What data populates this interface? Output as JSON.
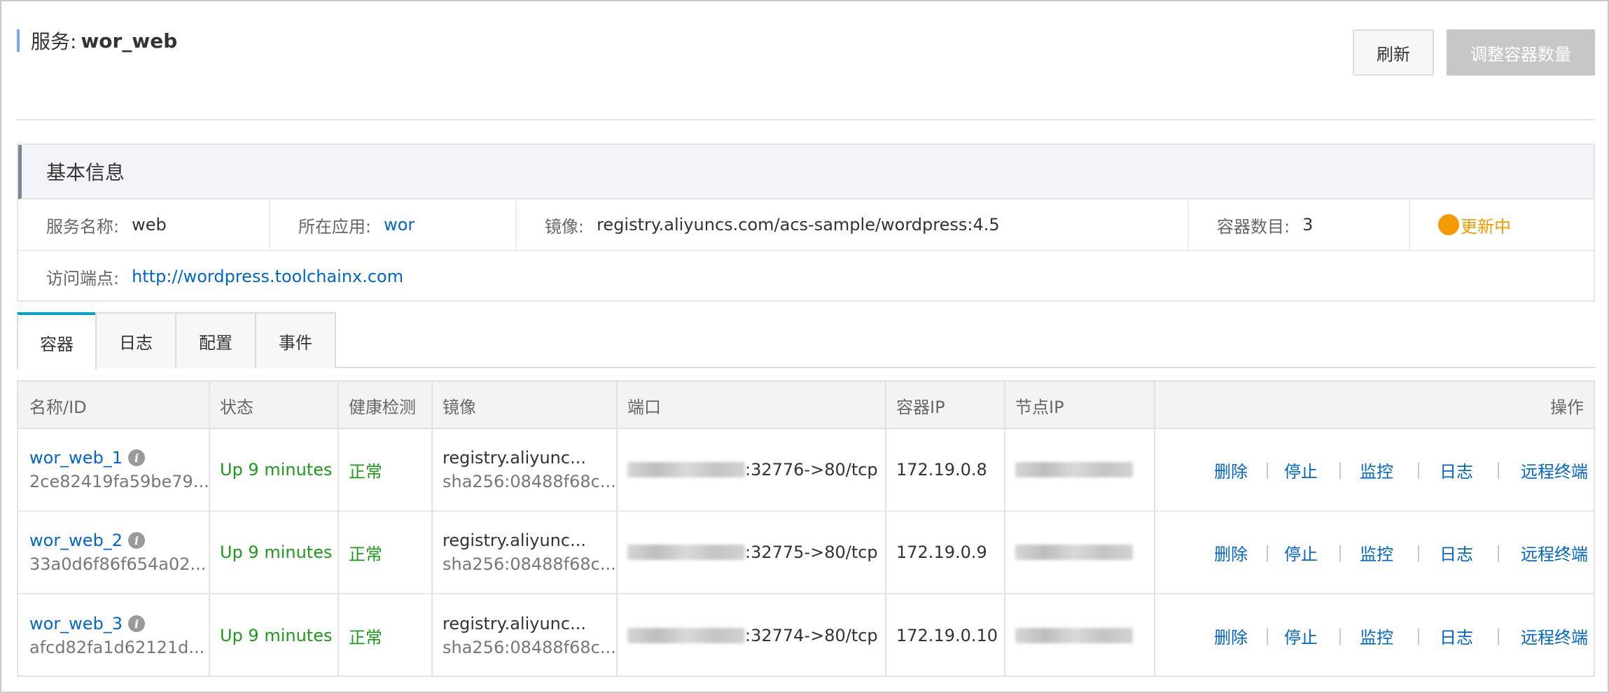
{
  "header": {
    "title_label": "服务:",
    "title_value": "wor_web"
  },
  "buttons": {
    "refresh": "刷新",
    "scale": "调整容器数量"
  },
  "basic_info": {
    "heading": "基本信息",
    "service_name_label": "服务名称:",
    "service_name": "web",
    "app_label": "所在应用:",
    "app": "wor",
    "image_label": "镜像:",
    "image": "registry.aliyuncs.com/acs-sample/wordpress:4.5",
    "container_count_label": "容器数目:",
    "container_count": "3",
    "status": "更新中",
    "endpoint_label": "访问端点:",
    "endpoint": "http://wordpress.toolchainx.com",
    "status_color": "#f59b00"
  },
  "tabs": [
    "容器",
    "日志",
    "配置",
    "事件"
  ],
  "table": {
    "headers": [
      "名称/ID",
      "状态",
      "健康检测",
      "镜像",
      "端口",
      "容器IP",
      "节点IP",
      "操作"
    ],
    "rows": [
      {
        "name": "wor_web_1",
        "id": "2ce82419fa59be79...",
        "state": "Up 9 minutes",
        "health": "正常",
        "image": "registry.aliyunc...",
        "digest": "sha256:08488f68c...",
        "port": ":32776->80/tcp",
        "container_ip": "172.19.0.8"
      },
      {
        "name": "wor_web_2",
        "id": "33a0d6f86f654a02...",
        "state": "Up 9 minutes",
        "health": "正常",
        "image": "registry.aliyunc...",
        "digest": "sha256:08488f68c...",
        "port": ":32775->80/tcp",
        "container_ip": "172.19.0.9"
      },
      {
        "name": "wor_web_3",
        "id": "afcd82fa1d62121d...",
        "state": "Up 9 minutes",
        "health": "正常",
        "image": "registry.aliyunc...",
        "digest": "sha256:08488f68c...",
        "port": ":32774->80/tcp",
        "container_ip": "172.19.0.10"
      }
    ],
    "actions": [
      "删除",
      "停止",
      "监控",
      "日志",
      "远程终端"
    ]
  },
  "colors": {
    "link": "#0066cc",
    "ok": "#1a9c1a",
    "tab_accent": "#00a2ca"
  }
}
